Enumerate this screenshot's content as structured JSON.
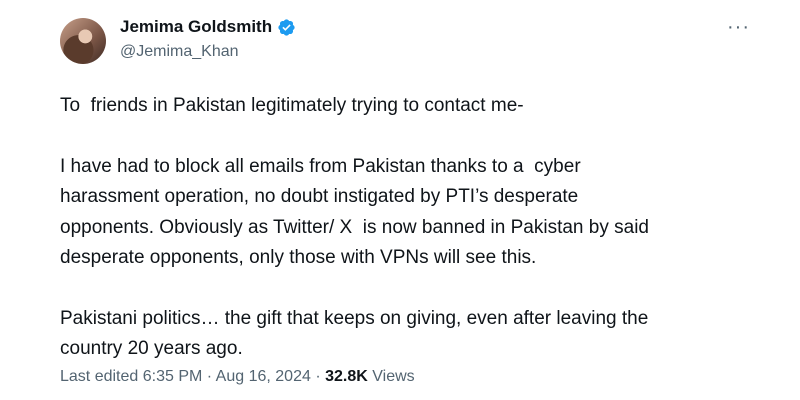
{
  "author": {
    "display_name": "Jemima Goldsmith",
    "handle": "@Jemima_Khan",
    "verified": true
  },
  "more_menu": "···",
  "tweet": {
    "paragraphs": [
      "To  friends in Pakistan legitimately trying to contact me-",
      "I have had to block all emails from Pakistan thanks to a  cyber\nharassment operation, no doubt instigated by PTI’s desperate\nopponents. Obviously as Twitter/ X  is now banned in Pakistan by said\ndesperate opponents, only those with VPNs will see this.",
      "Pakistani politics… the gift that keeps on giving, even after leaving the\ncountry 20 years ago."
    ]
  },
  "meta": {
    "edited_label": "Last edited",
    "time": "6:35 PM",
    "separator": "·",
    "date": "Aug 16, 2024",
    "views_count": "32.8K",
    "views_label": "Views"
  },
  "colors": {
    "verified_badge": "#1d9bf0",
    "text_primary": "#0f1419",
    "text_secondary": "#536471"
  }
}
